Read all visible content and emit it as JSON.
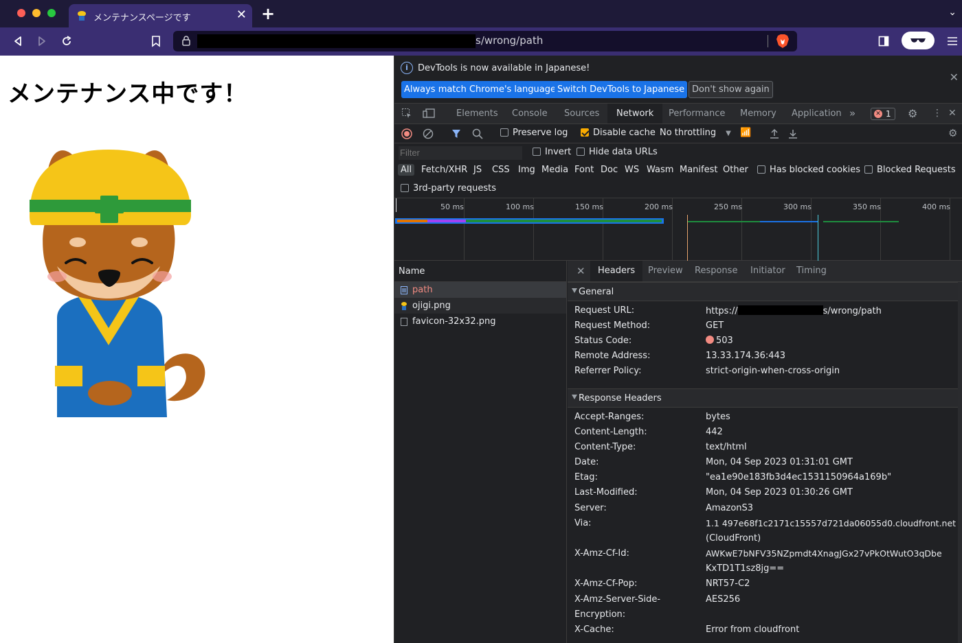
{
  "browser": {
    "tab_title": "メンテナンスページです",
    "url_path": "s/wrong/path"
  },
  "page": {
    "heading": "メンテナンス中です！"
  },
  "devtools": {
    "infobar": {
      "message": "DevTools is now available in Japanese!",
      "btn_match": "Always match Chrome's language",
      "btn_switch": "Switch DevTools to Japanese",
      "btn_dismiss": "Don't show again"
    },
    "tabs": [
      "Elements",
      "Console",
      "Sources",
      "Network",
      "Performance",
      "Memory",
      "Application"
    ],
    "error_count": "1",
    "toolbar": {
      "preserve_log": "Preserve log",
      "disable_cache": "Disable cache",
      "throttling": "No throttling"
    },
    "filter": {
      "placeholder": "Filter",
      "invert": "Invert",
      "hide_data_urls": "Hide data URLs",
      "types": [
        "All",
        "Fetch/XHR",
        "JS",
        "CSS",
        "Img",
        "Media",
        "Font",
        "Doc",
        "WS",
        "Wasm",
        "Manifest",
        "Other"
      ],
      "has_blocked_cookies": "Has blocked cookies",
      "blocked_requests": "Blocked Requests",
      "third_party": "3rd-party requests"
    },
    "timeline": {
      "ticks": [
        "50 ms",
        "100 ms",
        "150 ms",
        "200 ms",
        "250 ms",
        "300 ms",
        "350 ms",
        "400 ms"
      ]
    },
    "requests": {
      "header": "Name",
      "items": [
        "path",
        "ojigi.png",
        "favicon-32x32.png"
      ]
    },
    "details": {
      "tabs": [
        "Headers",
        "Preview",
        "Response",
        "Initiator",
        "Timing"
      ],
      "general": {
        "title": "General",
        "request_url_label": "Request URL:",
        "request_url_prefix": "https://",
        "request_url_suffix": "s/wrong/path",
        "request_method_label": "Request Method:",
        "request_method": "GET",
        "status_code_label": "Status Code:",
        "status_code": "503",
        "remote_address_label": "Remote Address:",
        "remote_address": "13.33.174.36:443",
        "referrer_policy_label": "Referrer Policy:",
        "referrer_policy": "strict-origin-when-cross-origin"
      },
      "response_headers": {
        "title": "Response Headers",
        "accept_ranges_label": "Accept-Ranges:",
        "accept_ranges": "bytes",
        "content_length_label": "Content-Length:",
        "content_length": "442",
        "content_type_label": "Content-Type:",
        "content_type": "text/html",
        "date_label": "Date:",
        "date": "Mon, 04 Sep 2023 01:31:01 GMT",
        "etag_label": "Etag:",
        "etag": "\"ea1e90e183fb3d4ec1531150964a169b\"",
        "last_modified_label": "Last-Modified:",
        "last_modified": "Mon, 04 Sep 2023 01:30:26 GMT",
        "server_label": "Server:",
        "server": "AmazonS3",
        "via_label": "Via:",
        "via_line1": "1.1 497e68f1c2171c15557d721da06055d0.cloudfront.net",
        "via_line2": "(CloudFront)",
        "amz_cf_id_label": "X-Amz-Cf-Id:",
        "amz_cf_id_line1": "AWKwE7bNFV35NZpmdt4XnagJGx27vPkOtWutO3qDbe",
        "amz_cf_id_line2": "KxTD1T1sz8jg==",
        "amz_cf_pop_label": "X-Amz-Cf-Pop:",
        "amz_cf_pop": "NRT57-C2",
        "sse_label_line1": "X-Amz-Server-Side-",
        "sse_label_line2": "Encryption:",
        "sse": "AES256",
        "x_cache_label": "X-Cache:",
        "x_cache": "Error from cloudfront"
      }
    }
  },
  "colors": {
    "accent": "#1a73e8",
    "status_error": "#f28b82",
    "brave": "#fb542b"
  }
}
